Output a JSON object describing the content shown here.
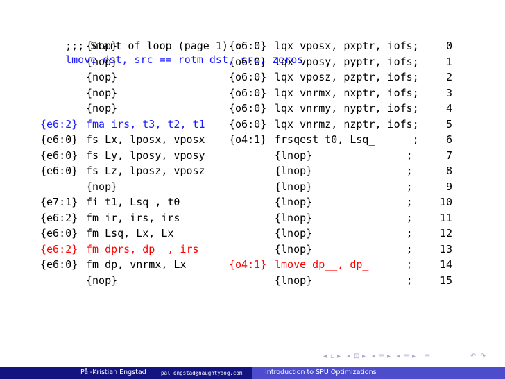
{
  "header": ";;; Start of loop (page 1) : lmove dst, src == rotm dst, src, zeros",
  "header_prefix": ";;; Start of loop (page 1) :",
  "header_code": "lmove dst, src == rotm dst, src, zeros",
  "left_rows": [
    {
      "label": "",
      "code": "{nop}",
      "color": "black"
    },
    {
      "label": "",
      "code": "{nop}",
      "color": "black"
    },
    {
      "label": "",
      "code": "{nop}",
      "color": "black"
    },
    {
      "label": "",
      "code": "{nop}",
      "color": "black"
    },
    {
      "label": "",
      "code": "{nop}",
      "color": "black"
    },
    {
      "label": "{e6:2}",
      "code": "fma irs, t3, t2, t1",
      "color": "blue"
    },
    {
      "label": "{e6:0}",
      "code": "fs Lx, lposx, vposx",
      "color": "black"
    },
    {
      "label": "{e6:0}",
      "code": "fs Ly, lposy, vposy",
      "color": "black"
    },
    {
      "label": "{e6:0}",
      "code": "fs Lz, lposz, vposz",
      "color": "black"
    },
    {
      "label": "",
      "code": "{nop}",
      "color": "black"
    },
    {
      "label": "{e7:1}",
      "code": "fi t1, Lsq_, t0",
      "color": "black"
    },
    {
      "label": "{e6:2}",
      "code": "fm ir, irs, irs",
      "color": "black"
    },
    {
      "label": "{e6:0}",
      "code": "fm Lsq, Lx, Lx",
      "color": "black"
    },
    {
      "label": "{e6:2}",
      "code": "fm dprs, dp__, irs",
      "color": "red"
    },
    {
      "label": "{e6:0}",
      "code": "fm dp, vnrmx, Lx",
      "color": "black"
    },
    {
      "label": "",
      "code": "{nop}",
      "color": "black"
    }
  ],
  "right_rows": [
    {
      "label": "{o6:0}",
      "code": "lqx vposx, pxptr, iofs;",
      "num": "0",
      "color": "black"
    },
    {
      "label": "{o6:0}",
      "code": "lqx vposy, pyptr, iofs;",
      "num": "1",
      "color": "black"
    },
    {
      "label": "{o6:0}",
      "code": "lqx vposz, pzptr, iofs;",
      "num": "2",
      "color": "black"
    },
    {
      "label": "{o6:0}",
      "code": "lqx vnrmx, nxptr, iofs;",
      "num": "3",
      "color": "black"
    },
    {
      "label": "{o6:0}",
      "code": "lqx vnrmy, nyptr, iofs;",
      "num": "4",
      "color": "black"
    },
    {
      "label": "{o6:0}",
      "code": "lqx vnrmz, nzptr, iofs;",
      "num": "5",
      "color": "black"
    },
    {
      "label": "{o4:1}",
      "code": "frsqest t0, Lsq_      ;",
      "num": "6",
      "color": "black"
    },
    {
      "label": "",
      "code": "{lnop}               ;",
      "num": "7",
      "color": "black"
    },
    {
      "label": "",
      "code": "{lnop}               ;",
      "num": "8",
      "color": "black"
    },
    {
      "label": "",
      "code": "{lnop}               ;",
      "num": "9",
      "color": "black"
    },
    {
      "label": "",
      "code": "{lnop}               ;",
      "num": "10",
      "color": "black"
    },
    {
      "label": "",
      "code": "{lnop}               ;",
      "num": "11",
      "color": "black"
    },
    {
      "label": "",
      "code": "{lnop}               ;",
      "num": "12",
      "color": "black"
    },
    {
      "label": "",
      "code": "{lnop}               ;",
      "num": "13",
      "color": "black"
    },
    {
      "label": "{o4:1}",
      "code": "lmove dp__, dp_      ;",
      "num": "14",
      "color": "red"
    },
    {
      "label": "",
      "code": "{lnop}               ;",
      "num": "15",
      "color": "black"
    }
  ],
  "nav_symbols": [
    "◂",
    "▫",
    "▸",
    "◂",
    "⊡",
    "▸",
    "◂",
    "≡",
    "▸",
    "◂",
    "≡",
    "▸",
    "≡",
    "↶",
    "↷"
  ],
  "footer": {
    "author": "Pål-Kristian Engstad",
    "email": "pal_engstad@naughtydog.com",
    "title": "Introduction to SPU Optimizations"
  },
  "colors": {
    "blue": "#1a1aff",
    "red": "#ff0000",
    "footer_dark": "#141480",
    "footer_light": "#4c4ccc"
  }
}
